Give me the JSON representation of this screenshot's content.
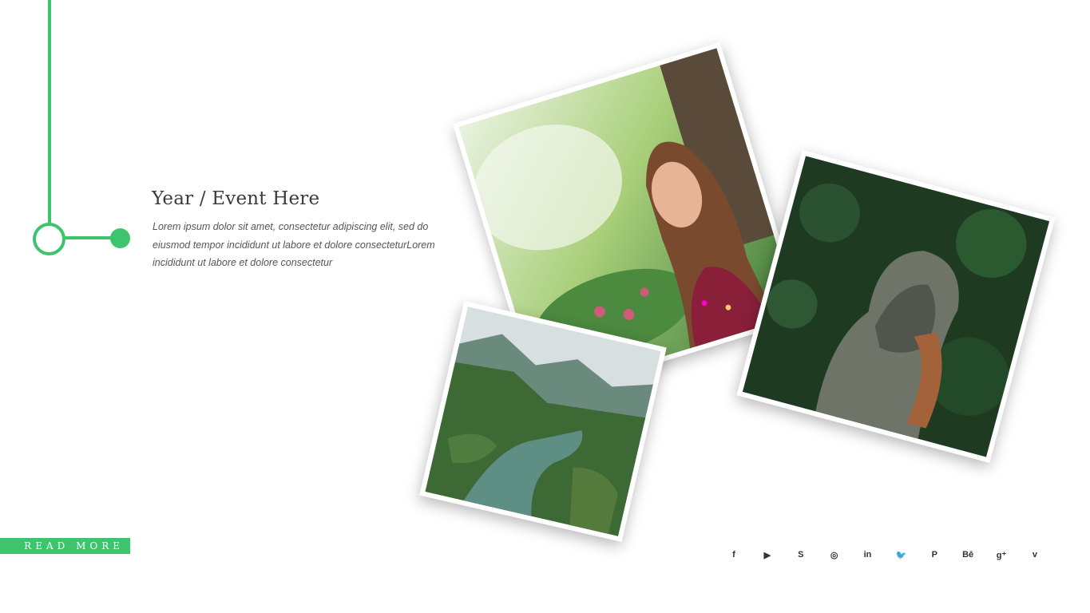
{
  "event": {
    "title": "Year / Event Here",
    "body": "Lorem  ipsum dolor sit amet, consectetur  adipiscing elit, sed do eiusmod tempor  incididunt ut labore et dolore consecteturLorem  incididunt ut labore et dolore consectetur"
  },
  "read_more_label": "READ MORE",
  "accent_color": "#3ec46d",
  "photos": [
    {
      "name": "smiling-woman-in-garden-photo"
    },
    {
      "name": "person-in-grey-hood-photo"
    },
    {
      "name": "mountain-lake-aerial-photo"
    }
  ],
  "social": [
    {
      "icon": "facebook-icon",
      "glyph": "f"
    },
    {
      "icon": "youtube-icon",
      "glyph": "▶"
    },
    {
      "icon": "skype-icon",
      "glyph": "S"
    },
    {
      "icon": "instagram-icon",
      "glyph": "◎"
    },
    {
      "icon": "linkedin-icon",
      "glyph": "in"
    },
    {
      "icon": "twitter-icon",
      "glyph": "🐦"
    },
    {
      "icon": "pinterest-icon",
      "glyph": "P"
    },
    {
      "icon": "behance-icon",
      "glyph": "Bē"
    },
    {
      "icon": "google-plus-icon",
      "glyph": "g⁺"
    },
    {
      "icon": "vimeo-icon",
      "glyph": "v"
    }
  ]
}
